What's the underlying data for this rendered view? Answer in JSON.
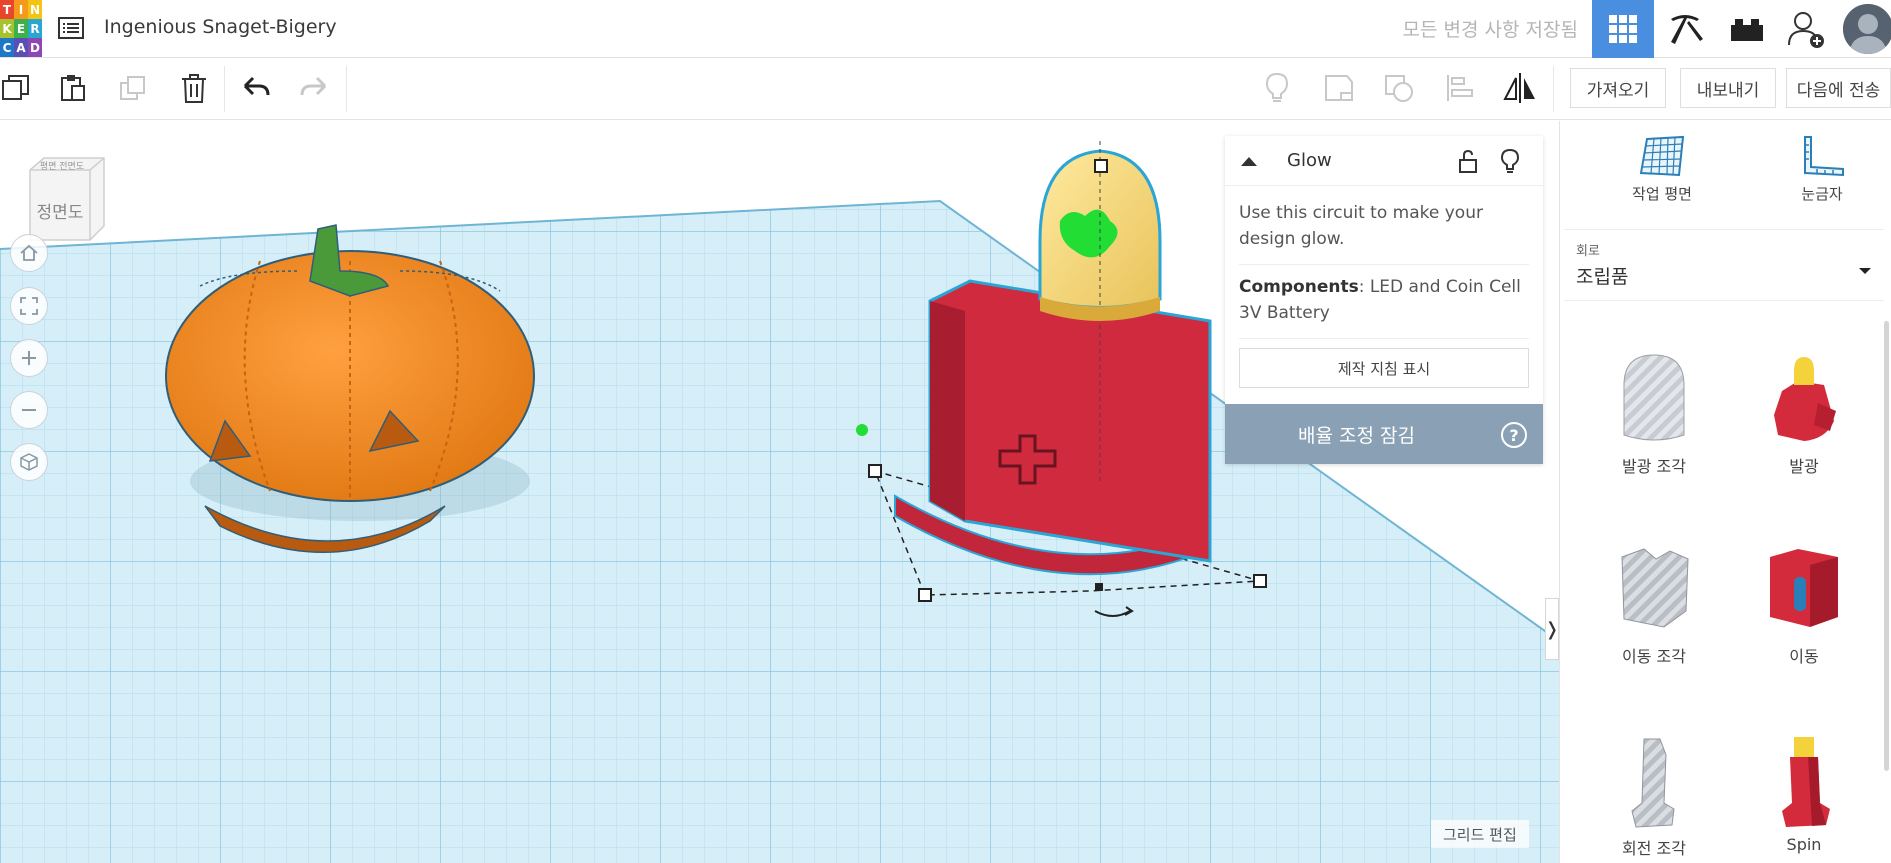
{
  "app": {
    "logo_letters": [
      "T",
      "I",
      "N",
      "K",
      "E",
      "R",
      "C",
      "A",
      "D"
    ],
    "document_title": "Ingenious Snaget-Bigery",
    "save_status": "모든 변경 사항 저장됨"
  },
  "header": {
    "views": [
      {
        "icon": "grid-3d-view-icon",
        "active": true
      },
      {
        "icon": "pickaxe-icon",
        "active": false
      },
      {
        "icon": "brick-icon",
        "active": false
      }
    ],
    "user_icon": "add-user-icon",
    "accent_color": "#4a8ee0"
  },
  "toolbar": {
    "left_tools": [
      "copy-icon",
      "paste-icon",
      "duplicate-icon",
      "trash-icon",
      "undo-icon",
      "redo-icon"
    ],
    "right_tools": [
      "light-bulb-icon",
      "note-icon",
      "group-icon",
      "align-icon",
      "mirror-icon"
    ],
    "import_label": "가져오기",
    "export_label": "내보내기",
    "send_label": "다음에 전송"
  },
  "workplane": {
    "viewcube_face": "정면도",
    "viewcube_top": "평면 전면도",
    "grid_edit_label": "그리드 편집",
    "grid_color": "#bfe3f2",
    "nav": [
      "home-icon",
      "fit-icon",
      "zoom-in-icon",
      "zoom-out-icon",
      "perspective-icon"
    ]
  },
  "inspector": {
    "title": "Glow",
    "description": "Use this circuit to make your design glow.",
    "components_label": "Components",
    "components_value": ": LED and Coin Cell 3V Battery",
    "guide_button": "제작 지침 표시",
    "scale_lock_label": "배율 조정 잠김",
    "help": "?"
  },
  "right_panel": {
    "workplane_label": "작업 평면",
    "ruler_label": "눈금자",
    "category_label": "회로",
    "category_value": "조립품",
    "shapes": [
      {
        "label": "발광 조각"
      },
      {
        "label": "발광"
      },
      {
        "label": "이동 조각"
      },
      {
        "label": "이동"
      },
      {
        "label": "회전 조각"
      },
      {
        "label": "Spin"
      }
    ]
  }
}
